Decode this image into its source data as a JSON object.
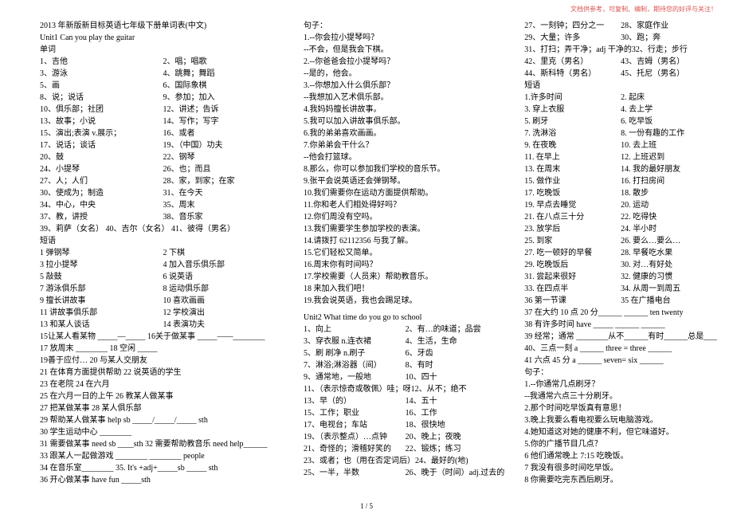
{
  "watermark": "文档供参考，可复制、编制，期待您的好评与关注！",
  "footer": "1 / 5",
  "col1": {
    "header": "2013 年新版新目标英语七年级下册单词表(中文)",
    "unit": "Unit1   Can you play the guitar",
    "sub1": "单词",
    "words": [
      [
        "1、吉他",
        "2、唱；唱歌"
      ],
      [
        "3、游泳",
        "4、跳舞；舞蹈"
      ],
      [
        "5、画",
        "6、国际象棋"
      ],
      [
        "8、说；说话",
        "9、参加；加入"
      ],
      [
        "10、俱乐部；社团",
        "12、讲述；告诉"
      ],
      [
        "13、故事；小说",
        "14、写作；写字"
      ],
      [
        "15、演出;表演 v.展示；",
        "16、或者"
      ],
      [
        "17、说话；谈话",
        "19、（中国）功夫"
      ],
      [
        "20、鼓",
        "22、钢琴"
      ],
      [
        "24、小提琴",
        "26、也；而且"
      ],
      [
        "27、人；人们",
        "28、家，到家；在家"
      ],
      [
        "30、使成为；制造",
        "31、在今天"
      ],
      [
        "34、中心，中央",
        "35、周末"
      ],
      [
        "37、教，讲授",
        "38、音乐家"
      ],
      [
        "39、莉萨（女名）      40、吉尔（女名）     41、彼得（男名）",
        ""
      ]
    ],
    "sub2": "短语",
    "phrases": [
      [
        "1 弹钢琴",
        "2 下棋"
      ],
      [
        "3 拉小提琴",
        "4 加入音乐俱乐部"
      ],
      [
        "5 敲鼓",
        "6 说英语"
      ],
      [
        "7 游泳俱乐部",
        "8 运动俱乐部"
      ],
      [
        "9 擅长讲故事",
        "10 喜欢画画"
      ],
      [
        "11 讲故事俱乐部",
        "12 学校演出"
      ],
      [
        "13 和某人谈话",
        "14 表演功夫"
      ]
    ],
    "fill": [
      "15让某人看某物 _____—_____  16关于做某事 _____——________",
      "17 放周末  ________     18 空闲  _____",
      "19善于应付…                 20 与某人交朋友",
      "21 在体育方面提供帮助        22 说英语的学生",
      "23 在老院                    24 在六月",
      "25 在六月一日的上午          26 教某人做某事",
      "27 把某做某事                28 某人俱乐部",
      "29 帮助某人做某事  help sb _____/_____/_____ sth",
      "30 学生运动中心 ________",
      "31 需要做某事 need sb ____sth 32 需要帮助教音乐 need help______",
      "33 跟某人一起做游戏 ________  ________ people",
      "34 在音乐室________  35. It's +adj+_____sb _____ sth",
      "36 开心做某事 have fun _____sth"
    ]
  },
  "col2": {
    "sub1": "句子：",
    "sentences": [
      "1.--你会拉小提琴吗？",
      "--不会，但是我会下棋。",
      "2.--你爸爸会拉小提琴吗？",
      "--是的，他会。",
      "3.--你想加入什么俱乐部？",
      "--我想加入艺术俱乐部。",
      "4.我妈妈擅长讲故事。",
      "5.我可以加入讲故事俱乐部。",
      "6.我的弟弟喜欢画画。",
      "7.你弟弟会干什么？",
      "--他会打篮球。",
      "8.那么，你可以参加我们学校的音乐节。",
      "9.张平会说英语还会弹钢琴。",
      "10.我们需要你在运动方面提供帮助。",
      "11.你和老人们相处得好吗？",
      "12.你们周没有空吗。",
      "13.我们需要学生参加学校的表演。",
      "14.请拨打 62112356 与我了解。",
      "15.它们轻松又简单。",
      "16.周末你有时间吗？",
      "17.学校需要（人员来）帮助教音乐。",
      "18 来加入我们吧！",
      "19.我会说英语，我也会踢足球。"
    ],
    "unit2": "Unit2   What time do you go to school",
    "words2": [
      [
        "1、向上",
        "2、有…的味道；品尝"
      ],
      [
        "3、穿衣服  n.连衣裙",
        "4、生活，生命"
      ],
      [
        "5、刷 刷净  n.刷子",
        "6、牙齿"
      ],
      [
        "7、淋浴;淋浴器（间）",
        "8、有时"
      ],
      [
        "9、通常地，一般地",
        "10、四十"
      ],
      [
        "11、（表示惊奇或敬佩）哇；呀",
        "12、从不；绝不"
      ],
      [
        "13、早（的）",
        "14、五十"
      ],
      [
        "15、工作；职业",
        "16、工作"
      ],
      [
        "17、电视台；车站",
        "18、很快地"
      ],
      [
        "19、（表示整点）…点钟",
        "20、晚上；夜晚"
      ],
      [
        "21、奇怪的；滑稽好笑的",
        "22、锻炼；练习"
      ],
      [
        "23、或者；也（用在否定词后）",
        "24、最好的(地)"
      ],
      [
        "25、一半，半数",
        "26、晚于（时间）adj.过去的"
      ]
    ]
  },
  "col3": {
    "words3": [
      [
        "27、一刻钟；四分之一",
        "28、家庭作业"
      ],
      [
        "29、大量；许多",
        "30、跑；奔"
      ],
      [
        "31、打扫；弄干净；adj 干净的",
        "32、行走；步行"
      ],
      [
        "42、里克（男名）",
        "43、吉姆（男名）"
      ],
      [
        "44、斯科特（男名）",
        "45、托尼（男名）"
      ]
    ],
    "sub2": "短语",
    "phrases2": [
      [
        "1.许多时间",
        "2. 起床"
      ],
      [
        "3. 穿上衣服",
        "4. 去上学"
      ],
      [
        "5. 刷牙",
        "6. 吃早饭"
      ],
      [
        "7. 洗淋浴",
        "8. 一份有趣的工作"
      ],
      [
        "9. 在夜晚",
        "10. 去上班"
      ],
      [
        "11. 在早上",
        "12. 上班迟到"
      ],
      [
        "13. 在周末",
        "14. 我的最好朋友"
      ],
      [
        "15. 做作业",
        "16. 打扫房间"
      ],
      [
        "17. 吃晚饭",
        "18. 散步"
      ],
      [
        "19. 早点去睡觉",
        "20. 运动"
      ],
      [
        "21. 在八点三十分",
        "22. 吃得快"
      ],
      [
        "23. 放学后",
        "24. 半小时"
      ],
      [
        "25. 到家",
        "26. 要么…要么…"
      ],
      [
        "27. 吃一顿好的早餐",
        "28. 早餐吃水果"
      ],
      [
        "29. 吃晚饭后",
        "30. 对…有好处"
      ],
      [
        "31. 尝起来很好",
        "32. 健康的习惯"
      ],
      [
        "33. 在四点半",
        "34. 从周一到周五"
      ],
      [
        "36 第一节课",
        "35 在广播电台"
      ]
    ],
    "fill2": [
      "37 在大约 10 点 20 分______   ______ ten twenty",
      "38 有许多时间 have _____  ______  ______",
      "39 经常；通常 ________从不______有时______总是______",
      "40、三点一刻 a ______ three = three ______",
      "41 六点 45 分 a ______ seven= six ______"
    ],
    "sub3": "句子：",
    "sentences2": [
      "1.--你通常几点刷牙？",
      "--我通常六点三十分刷牙。",
      "2.那个时间吃早饭真有意思！",
      "3.晚上我要么看电视要么玩电脑游戏。",
      "4.她知道这对她的健康不利，但它味道好。",
      "5.你的广播节目几点？",
      "6 他们通常晚上 7:15 吃晚饭。",
      "7 我没有很多时间吃早饭。",
      "8 你需要吃完东西后刷牙。"
    ]
  }
}
